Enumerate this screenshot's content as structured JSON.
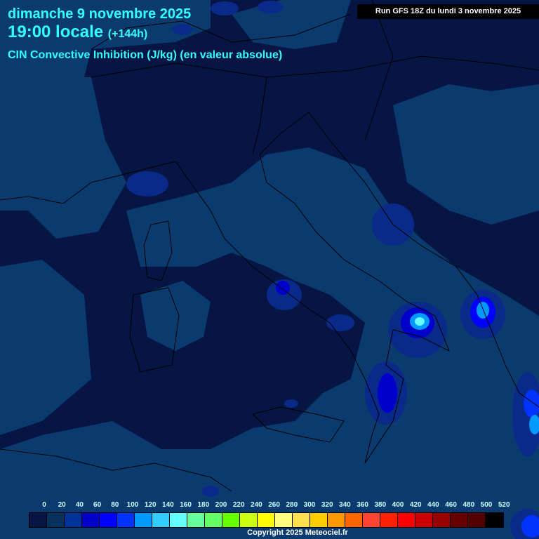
{
  "header": {
    "date": "dimanche 9 novembre 2025",
    "time": "19:00 locale",
    "lead": "(+144h)",
    "parameter": "CIN Convective Inhibition (J/kg) (en valeur absolue)",
    "run": "Run GFS 18Z du lundi 3 novembre 2025"
  },
  "legend": {
    "labels": [
      "0",
      "20",
      "40",
      "60",
      "80",
      "100",
      "120",
      "140",
      "160",
      "180",
      "200",
      "220",
      "240",
      "260",
      "280",
      "300",
      "320",
      "340",
      "360",
      "380",
      "400",
      "420",
      "440",
      "460",
      "480",
      "500",
      "520"
    ],
    "colors": [
      "#061544",
      "#07325e",
      "#003399",
      "#0000cc",
      "#0000ff",
      "#0033ff",
      "#0099ff",
      "#33ccff",
      "#66ffff",
      "#66ff99",
      "#66ff66",
      "#66ff00",
      "#ccff11",
      "#ffff00",
      "#ffff80",
      "#ffe050",
      "#ffcc00",
      "#ff9900",
      "#ff6600",
      "#ff4433",
      "#ff2200",
      "#ff0000",
      "#cc0000",
      "#990000",
      "#660000",
      "#550000",
      "#000000"
    ]
  },
  "copyright": "Copyright 2025 Meteociel.fr"
}
